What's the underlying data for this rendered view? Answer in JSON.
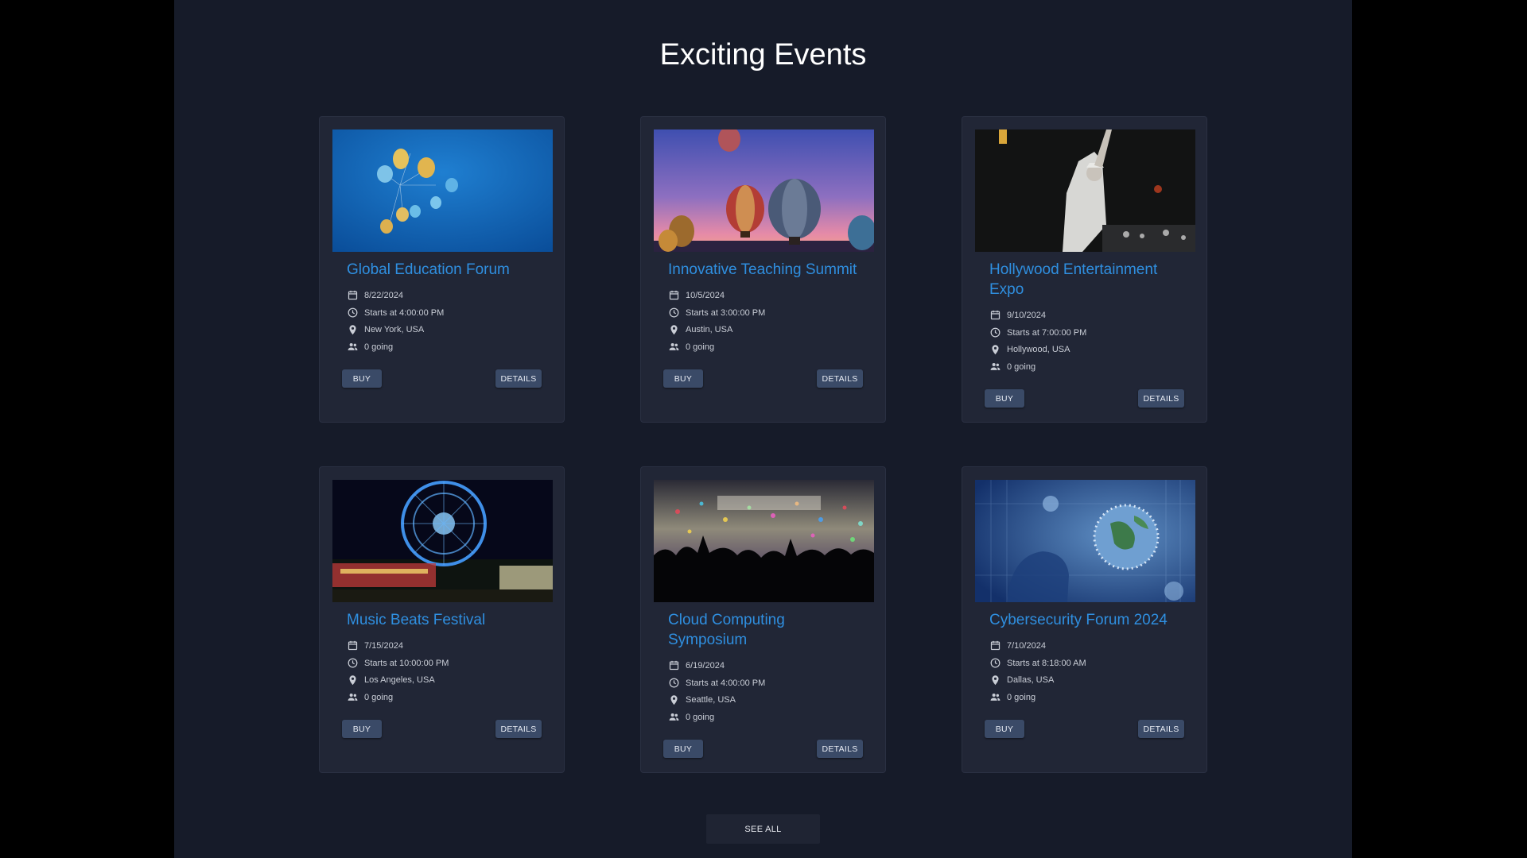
{
  "page": {
    "title": "Exciting Events"
  },
  "events": [
    {
      "title": "Global Education Forum",
      "date": "8/22/2024",
      "time": "Starts at 4:00:00 PM",
      "location": "New York, USA",
      "going": "0 going",
      "image": "balloons-sky"
    },
    {
      "title": "Innovative Teaching Summit",
      "date": "10/5/2024",
      "time": "Starts at 3:00:00 PM",
      "location": "Austin, USA",
      "going": "0 going",
      "image": "hot-air-balloons"
    },
    {
      "title": "Hollywood Entertainment Expo",
      "date": "9/10/2024",
      "time": "Starts at 7:00:00 PM",
      "location": "Hollywood, USA",
      "going": "0 going",
      "image": "dj-performer"
    },
    {
      "title": "Music Beats Festival",
      "date": "7/15/2024",
      "time": "Starts at 10:00:00 PM",
      "location": "Los Angeles, USA",
      "going": "0 going",
      "image": "ferris-wheel-night"
    },
    {
      "title": "Cloud Computing Symposium",
      "date": "6/19/2024",
      "time": "Starts at 4:00:00 PM",
      "location": "Seattle, USA",
      "going": "0 going",
      "image": "concert-crowd-lights"
    },
    {
      "title": "Cybersecurity Forum 2024",
      "date": "7/10/2024",
      "time": "Starts at 8:18:00 AM",
      "location": "Dallas, USA",
      "going": "0 going",
      "image": "globe-virus-digital"
    }
  ],
  "buttons": {
    "buy": "BUY",
    "details": "DETAILS",
    "see_all": "SEE ALL"
  },
  "icons": {
    "date": "calendar-icon",
    "time": "clock-icon",
    "location": "location-pin-icon",
    "going": "people-icon"
  },
  "colors": {
    "page_bg": "#161b29",
    "card_bg": "#212636",
    "title_link": "#2f8fe0",
    "button_bg": "#3a4a67"
  }
}
